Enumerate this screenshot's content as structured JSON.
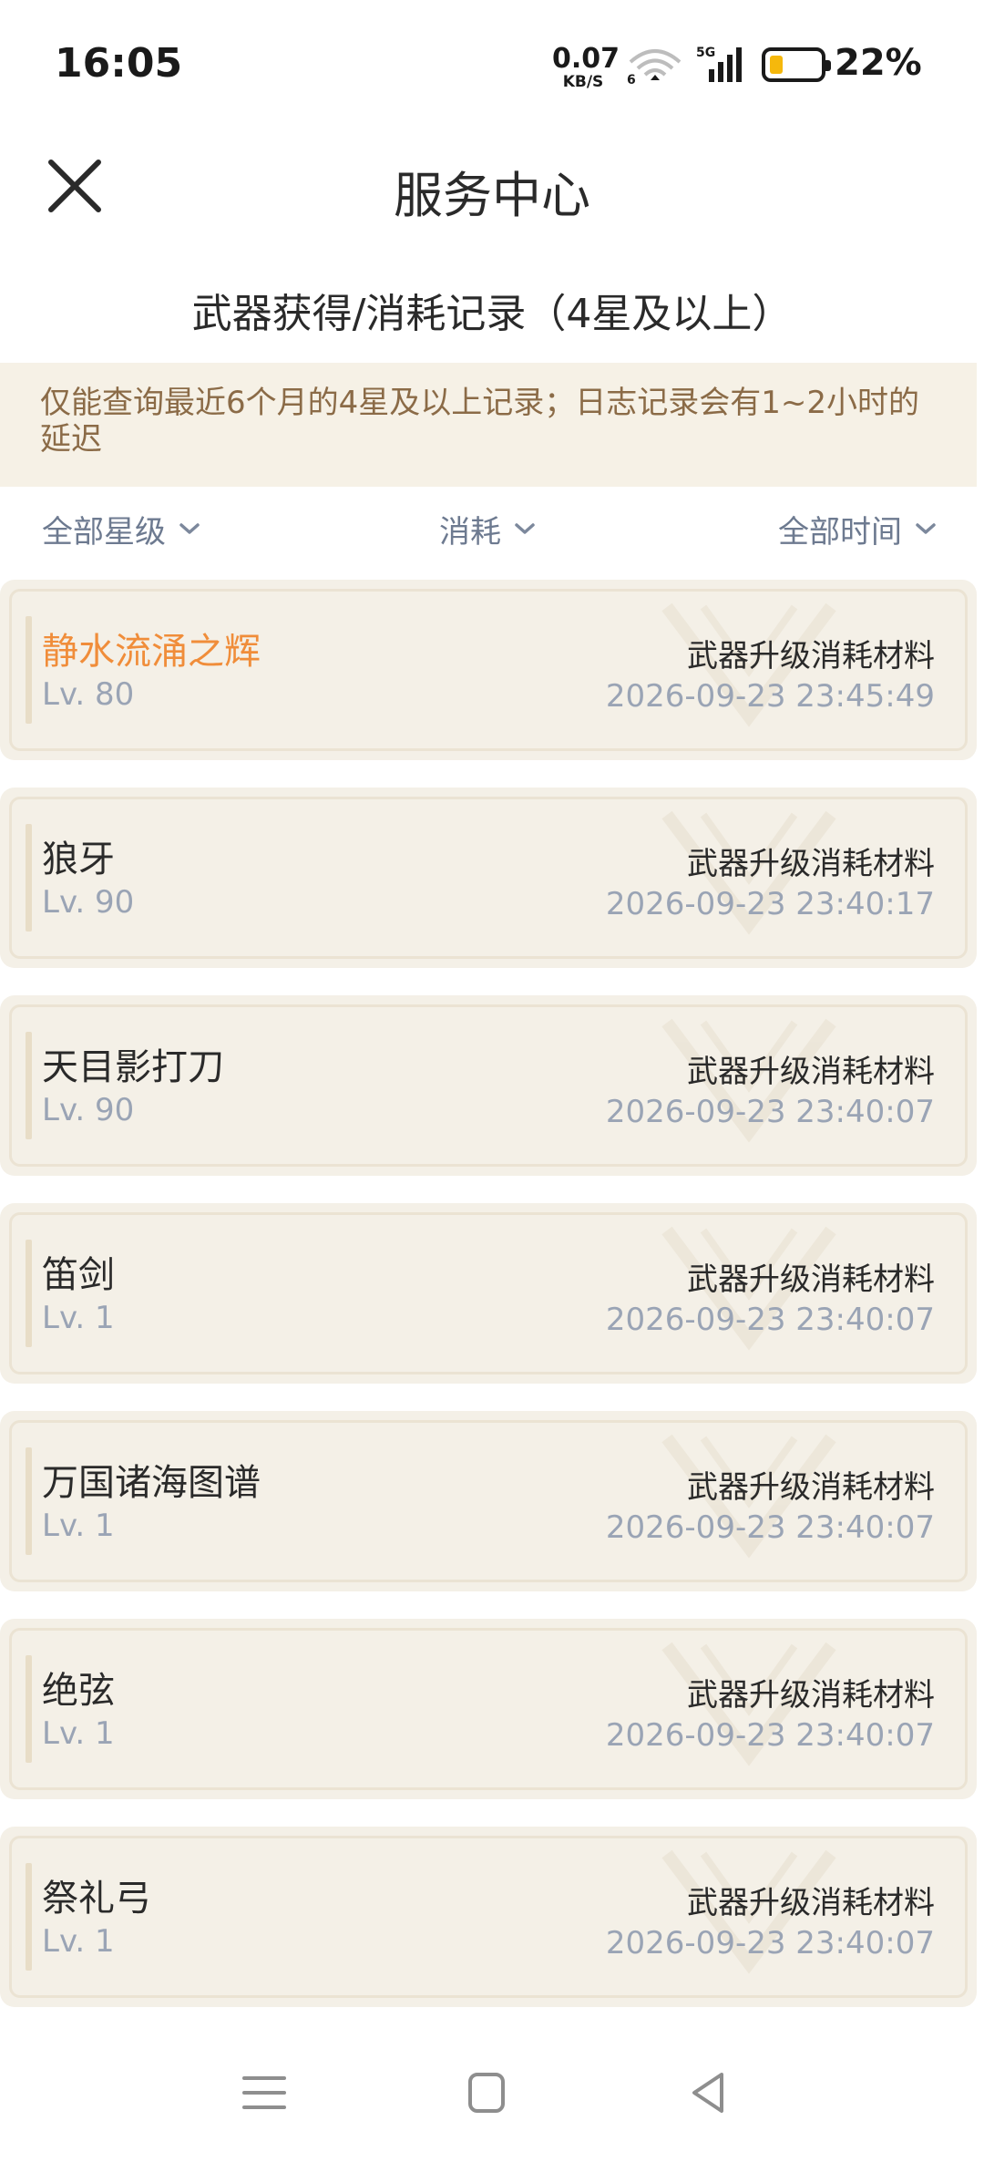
{
  "status_bar": {
    "time": "16:05",
    "net_speed_value": "0.07",
    "net_speed_unit": "KB/S",
    "wifi_badge": "6",
    "signal_label": "5G",
    "battery_percent": "22%",
    "battery_level": 0.22,
    "battery_color": "#f5b80c"
  },
  "header": {
    "title": "服务中心",
    "subtitle": "武器获得/消耗记录（4星及以上）"
  },
  "notice": "仅能查询最近6个月的4星及以上记录；日志记录会有1~2小时的延迟",
  "filters": {
    "star": "全部星级",
    "type": "消耗",
    "time": "全部时间"
  },
  "records": [
    {
      "name": "静水流涌之辉",
      "level": "Lv. 80",
      "type": "武器升级消耗材料",
      "timestamp": "2026-09-23 23:45:49",
      "highlight": true
    },
    {
      "name": "狼牙",
      "level": "Lv. 90",
      "type": "武器升级消耗材料",
      "timestamp": "2026-09-23 23:40:17",
      "highlight": false
    },
    {
      "name": "天目影打刀",
      "level": "Lv. 90",
      "type": "武器升级消耗材料",
      "timestamp": "2026-09-23 23:40:07",
      "highlight": false
    },
    {
      "name": "笛剑",
      "level": "Lv. 1",
      "type": "武器升级消耗材料",
      "timestamp": "2026-09-23 23:40:07",
      "highlight": false
    },
    {
      "name": "万国诸海图谱",
      "level": "Lv. 1",
      "type": "武器升级消耗材料",
      "timestamp": "2026-09-23 23:40:07",
      "highlight": false
    },
    {
      "name": "绝弦",
      "level": "Lv. 1",
      "type": "武器升级消耗材料",
      "timestamp": "2026-09-23 23:40:07",
      "highlight": false
    },
    {
      "name": "祭礼弓",
      "level": "Lv. 1",
      "type": "武器升级消耗材料",
      "timestamp": "2026-09-23 23:40:07",
      "highlight": false
    }
  ],
  "colors": {
    "accent_orange": "#f08d3a",
    "notice_bg": "#f6f1e6",
    "notice_text": "#8b6b47",
    "card_bg": "#f4f0e7",
    "muted_text": "#9aa4b5"
  },
  "icons": {
    "close": "close-icon",
    "chevron": "chevron-down-icon",
    "nav_menu": "menu-icon",
    "nav_home": "square-home-icon",
    "nav_back": "triangle-back-icon"
  }
}
